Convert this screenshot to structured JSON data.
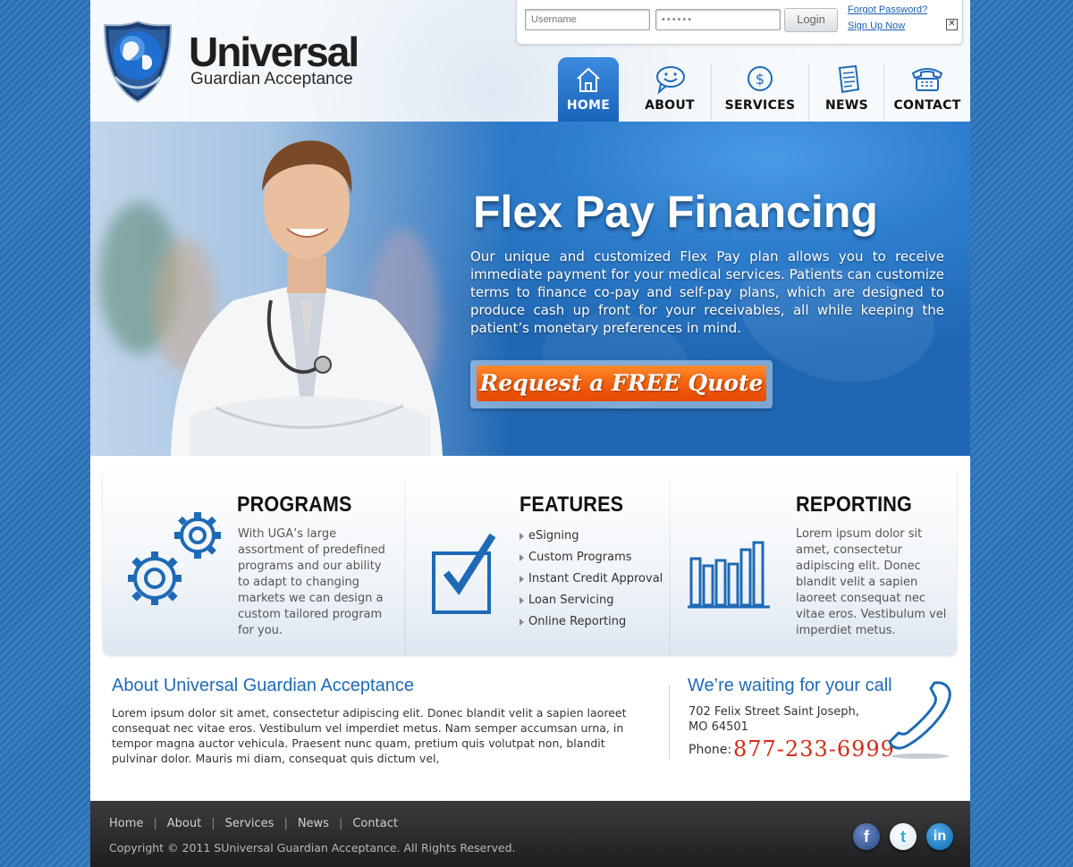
{
  "header": {
    "logo_title": "Universal",
    "logo_subtitle": "Guardian Acceptance",
    "login": {
      "username_placeholder": "Username",
      "password_value": "••••••",
      "login_label": "Login",
      "forgot_label": "Forgot Password?",
      "signup_label": "Sign Up Now",
      "close_icon": "close-icon"
    },
    "nav": [
      {
        "label": "HOME",
        "icon": "home-icon",
        "active": true
      },
      {
        "label": "ABOUT",
        "icon": "smiley-chat-icon",
        "active": false
      },
      {
        "label": "SERVICES",
        "icon": "dollar-icon",
        "active": false
      },
      {
        "label": "NEWS",
        "icon": "document-icon",
        "active": false
      },
      {
        "label": "CONTACT",
        "icon": "telephone-icon",
        "active": false
      }
    ]
  },
  "hero": {
    "title": "Flex Pay Financing",
    "text": "Our unique and customized Flex Pay plan allows you to receive immediate payment for your medical services. Patients can customize terms to finance co-pay and self-pay plans, which are designed to produce cash up front for your receivables, all while keeping the patient’s monetary preferences in mind.",
    "cta_label": "Request a FREE Quote",
    "cta_color": "#f25a0a"
  },
  "columns": {
    "programs": {
      "title": "PROGRAMS",
      "icon": "gears-icon",
      "text": "With UGA’s large assortment of predefined programs and our ability to adapt to changing markets we can design a custom tailored program for you."
    },
    "features": {
      "title": "FEATURES",
      "icon": "checkbox-icon",
      "items": [
        "eSigning",
        "Custom Programs",
        "Instant Credit Approval",
        "Loan Servicing",
        "Online Reporting"
      ]
    },
    "reporting": {
      "title": "REPORTING",
      "icon": "bar-chart-icon",
      "text": "Lorem ipsum dolor sit amet, consectetur adipiscing elit. Donec blandit velit a sapien laoreet consequat nec vitae eros. Vestibulum vel imperdiet metus."
    }
  },
  "about": {
    "title": "About Universal Guardian Acceptance",
    "text": "Lorem ipsum dolor sit amet, consectetur adipiscing elit. Donec blandit velit a sapien laoreet consequat nec vitae eros. Vestibulum vel imperdiet metus. Nam semper accumsan urna, in tempor magna auctor vehicula. Praesent nunc quam, pretium quis volutpat non, blandit pulvinar dolor. Mauris mi diam, consequat quis dictum vel,"
  },
  "contact": {
    "title": "We’re waiting for your call",
    "address_line1": "702 Felix Street Saint Joseph,",
    "address_line2": "MO 64501",
    "phone_label": "Phone:",
    "phone_number": "877-233-6999",
    "phone_color": "#d62b18"
  },
  "footer": {
    "links": [
      "Home",
      "About",
      "Services",
      "News",
      "Contact"
    ],
    "copyright": "Copyright © 2011 SUniversal Guardian Acceptance. All Rights Reserved.",
    "social": [
      {
        "icon": "facebook-icon",
        "glyph": "f",
        "color": "#3b5998"
      },
      {
        "icon": "twitter-icon",
        "glyph": "t",
        "color": "#29a9e0"
      },
      {
        "icon": "linkedin-icon",
        "glyph": "in",
        "color": "#1f7bc1"
      }
    ]
  },
  "colors": {
    "brand_blue": "#1e6ab6",
    "nav_active": "#2a74c9",
    "footer_bg": "#2a2b2c"
  }
}
